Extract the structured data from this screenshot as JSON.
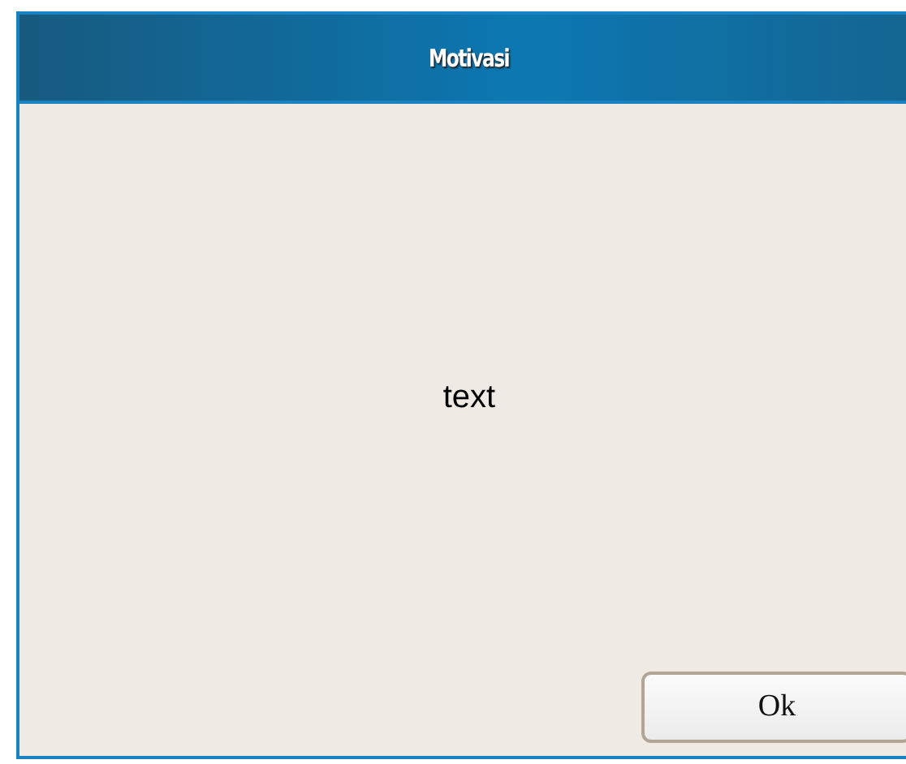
{
  "window": {
    "title": "Motivasi"
  },
  "message": "text",
  "buttons": [
    "Ok"
  ]
}
